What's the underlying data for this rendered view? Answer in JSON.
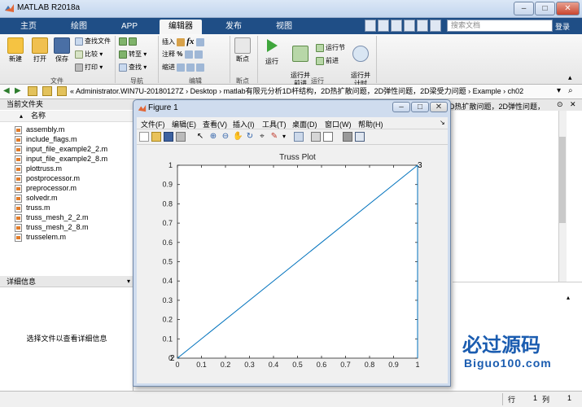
{
  "app": {
    "title": "MATLAB R2018a"
  },
  "tabs": [
    {
      "label": "主页"
    },
    {
      "label": "绘图"
    },
    {
      "label": "APP"
    },
    {
      "label": "编辑器"
    },
    {
      "label": "发布"
    },
    {
      "label": "视图"
    }
  ],
  "search": {
    "placeholder": "搜索文档",
    "login": "登录"
  },
  "ribbon": {
    "file": {
      "new": "新建",
      "open": "打开",
      "save": "保存",
      "find_files": "查找文件",
      "compare": "比较",
      "print": "打印",
      "group": "文件"
    },
    "nav": {
      "goto": "转至",
      "find": "查找",
      "group": "导航"
    },
    "edit": {
      "insert": "插入",
      "comment": "注释",
      "indent": "缩进",
      "group": "编辑"
    },
    "breakpoint": {
      "label": "断点",
      "group": "断点"
    },
    "run": {
      "run": "运行",
      "run_advance": "运行并\n前进",
      "run_section": "运行节",
      "advance": "前进",
      "run_time": "运行并\n计时",
      "group": "运行"
    }
  },
  "address": {
    "path": "« Administrator.WIN7U-20180127Z › Desktop › matlab有限元分析1D杆结构，2D热扩散问题，2D弹性问题，2D梁受力问题 › Example › ch02"
  },
  "file_panel": {
    "title": "当前文件夹",
    "column": "名称",
    "files": [
      "assembly.m",
      "include_flags.m",
      "input_file_example2_2.m",
      "input_file_example2_8.m",
      "plottruss.m",
      "postprocessor.m",
      "preprocessor.m",
      "solvedr.m",
      "truss.m",
      "truss_mesh_2_2.m",
      "truss_mesh_2_8.m",
      "trusselem.m"
    ]
  },
  "detail_panel": {
    "title": "详细信息",
    "message": "选择文件以查看详细信息"
  },
  "right_header": "D热扩散问题，2D弹性问题，",
  "status": {
    "row_label": "行",
    "row_value": "1",
    "col_label": "列",
    "col_value": "1"
  },
  "figure": {
    "title": "Figure 1",
    "menus": [
      "文件(F)",
      "编辑(E)",
      "查看(V)",
      "插入(I)",
      "工具(T)",
      "桌面(D)",
      "窗口(W)",
      "帮助(H)"
    ]
  },
  "watermark": {
    "cn": "必过源码",
    "url": "Biguo100.com"
  },
  "colors": {
    "tab_bar": "#1f4e86",
    "plot_line": "#0072bd",
    "watermark": "#1a5cb0"
  },
  "chart_data": {
    "type": "line",
    "title": "Truss Plot",
    "xlabel": "",
    "ylabel": "",
    "xlim": [
      0,
      1
    ],
    "ylim": [
      0,
      1
    ],
    "xticks": [
      0,
      0.1,
      0.2,
      0.3,
      0.4,
      0.5,
      0.6,
      0.7,
      0.8,
      0.9,
      1
    ],
    "yticks": [
      0,
      0.1,
      0.2,
      0.3,
      0.4,
      0.5,
      0.6,
      0.7,
      0.8,
      0.9,
      1
    ],
    "grid": false,
    "series": [
      {
        "x": [
          0,
          1
        ],
        "y": [
          0,
          1
        ]
      },
      {
        "x": [
          1,
          1
        ],
        "y": [
          1,
          0
        ]
      }
    ],
    "node_labels": [
      {
        "text": "2",
        "x": 0,
        "y": 0
      },
      {
        "text": "3",
        "x": 1,
        "y": 1
      }
    ]
  }
}
